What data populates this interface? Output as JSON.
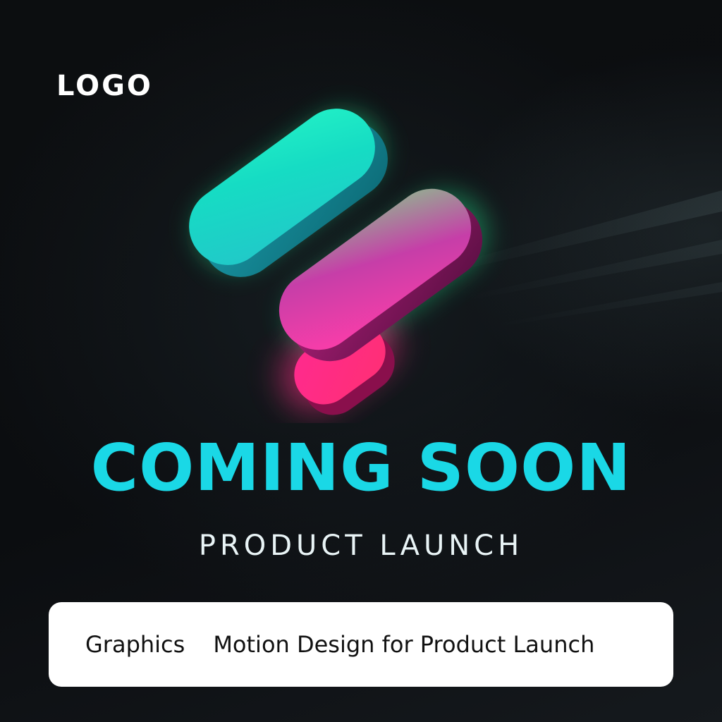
{
  "brand": {
    "logo_text": "LOGO"
  },
  "hero": {
    "headline": "COMING SOON",
    "subheadline": "PRODUCT LAUNCH"
  },
  "tag_card": {
    "category": "Graphics",
    "title": "Motion Design for Product Launch"
  },
  "colors": {
    "background": "#0b0d10",
    "headline": "#1ad8e6",
    "mark_teal": "#1ad3c6",
    "mark_pink": "#ff2a8f",
    "card": "#ffffff"
  },
  "icons": {
    "mark": "two-pill-logo-mark-icon"
  }
}
